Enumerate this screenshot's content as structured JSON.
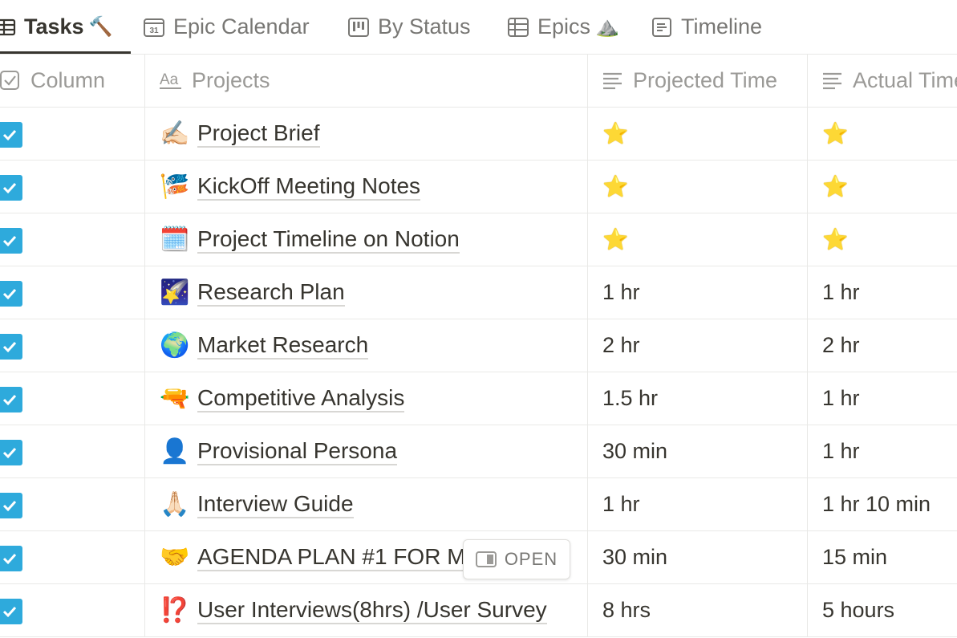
{
  "tabs": [
    {
      "label": "Tasks",
      "emoji": "🔨",
      "icon": "table-icon",
      "active": true
    },
    {
      "label": "Epic Calendar",
      "emoji": "",
      "icon": "calendar-icon",
      "active": false
    },
    {
      "label": "By Status",
      "emoji": "",
      "icon": "board-icon",
      "active": false
    },
    {
      "label": "Epics",
      "emoji": "⛰️",
      "icon": "table-icon",
      "active": false
    },
    {
      "label": "Timeline",
      "emoji": "",
      "icon": "timeline-icon",
      "active": false
    }
  ],
  "columns": [
    {
      "label": "Column",
      "icon": "checkbox-icon"
    },
    {
      "label": "Projects",
      "icon": "title-aa-icon"
    },
    {
      "label": "Projected Time",
      "icon": "text-lines-icon"
    },
    {
      "label": "Actual Time",
      "icon": "text-lines-icon"
    }
  ],
  "rows": [
    {
      "done": true,
      "emoji": "✍🏻",
      "title": "Project Brief",
      "projected": "⭐",
      "actual": "⭐"
    },
    {
      "done": true,
      "emoji": "🎏",
      "title": "KickOff Meeting Notes",
      "projected": "⭐",
      "actual": "⭐"
    },
    {
      "done": true,
      "emoji": "🗓️",
      "title": "Project Timeline on Notion",
      "projected": "⭐",
      "actual": "⭐"
    },
    {
      "done": true,
      "emoji": "🌠",
      "title": "Research Plan",
      "projected": "1 hr",
      "actual": "1 hr"
    },
    {
      "done": true,
      "emoji": "🌍",
      "title": "Market Research",
      "projected": "2 hr",
      "actual": "2 hr"
    },
    {
      "done": true,
      "emoji": "🔫",
      "title": "Competitive Analysis",
      "projected": "1.5 hr",
      "actual": "1 hr"
    },
    {
      "done": true,
      "emoji": "👤",
      "title": "Provisional Persona",
      "projected": "30 min",
      "actual": "1 hr"
    },
    {
      "done": true,
      "emoji": "🙏🏻",
      "title": "Interview Guide",
      "projected": "1 hr",
      "actual": "1 hr 10 min"
    },
    {
      "done": true,
      "emoji": "🤝",
      "title": "AGENDA PLAN #1 FOR M",
      "projected": "30 min",
      "actual": "15 min"
    },
    {
      "done": true,
      "emoji": "⁉️",
      "title": "User Interviews(8hrs) /User Survey",
      "projected": "8 hrs",
      "actual": "5 hours"
    }
  ],
  "open_button": {
    "label": "OPEN",
    "icon": "side-peek-icon"
  },
  "colors": {
    "checkbox": "#2eaadc",
    "text": "#37352f",
    "muted": "#9b9a97",
    "star": "#f5c518"
  }
}
